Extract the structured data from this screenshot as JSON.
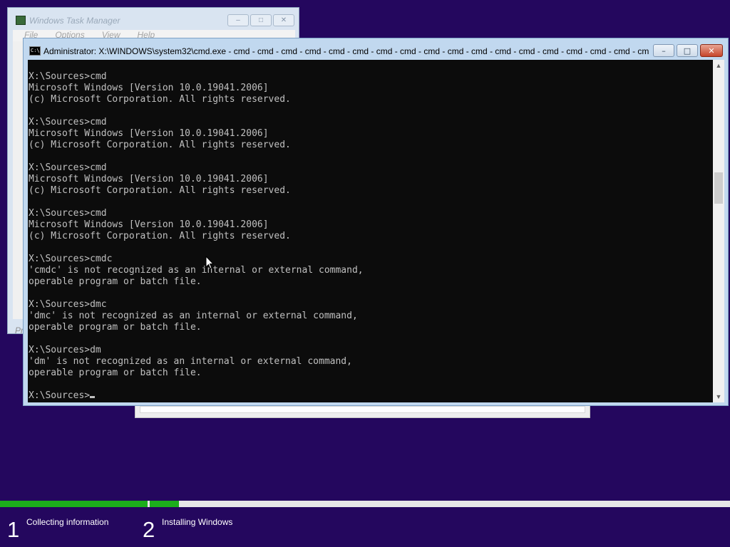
{
  "task_manager": {
    "title": "Windows Task Manager",
    "menu": [
      "File",
      "Options",
      "View",
      "Help"
    ],
    "status_text": "Pr"
  },
  "cmd": {
    "title": "Administrator: X:\\WINDOWS\\system32\\cmd.exe - cmd - cmd - cmd - cmd - cmd - cmd - cmd - cmd - cmd - cmd - cmd - cmd - cmd - cmd - cmd - cmd - cmd - cm...",
    "icon_text": "C:\\",
    "lines": [
      "X:\\Sources>cmd",
      "Microsoft Windows [Version 10.0.19041.2006]",
      "(c) Microsoft Corporation. All rights reserved.",
      "",
      "X:\\Sources>cmd",
      "Microsoft Windows [Version 10.0.19041.2006]",
      "(c) Microsoft Corporation. All rights reserved.",
      "",
      "X:\\Sources>cmd",
      "Microsoft Windows [Version 10.0.19041.2006]",
      "(c) Microsoft Corporation. All rights reserved.",
      "",
      "X:\\Sources>cmd",
      "Microsoft Windows [Version 10.0.19041.2006]",
      "(c) Microsoft Corporation. All rights reserved.",
      "",
      "X:\\Sources>cmdc",
      "'cmdc' is not recognized as an internal or external command,",
      "operable program or batch file.",
      "",
      "X:\\Sources>dmc",
      "'dmc' is not recognized as an internal or external command,",
      "operable program or batch file.",
      "",
      "X:\\Sources>dm",
      "'dm' is not recognized as an internal or external command,",
      "operable program or batch file.",
      ""
    ],
    "prompt": "X:\\Sources>"
  },
  "setup": {
    "steps": [
      {
        "number": "1",
        "label": "Collecting information",
        "progress": 1.0
      },
      {
        "number": "2",
        "label": "Installing Windows",
        "progress": 0.05
      }
    ],
    "colors": {
      "background": "#24075e",
      "progress_fill": "#1cae1c"
    }
  }
}
